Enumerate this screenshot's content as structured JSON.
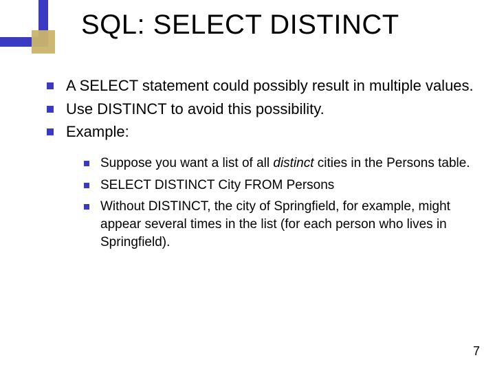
{
  "title": "SQL: SELECT DISTINCT",
  "bullets": [
    {
      "text": "A SELECT statement could possibly result in multiple values."
    },
    {
      "text": "Use DISTINCT to avoid this possibility."
    },
    {
      "text": "Example:"
    }
  ],
  "sub_bullets": [
    {
      "pre": "Suppose you want a list of all ",
      "em": "distinct",
      "post": " cities in the Persons table."
    },
    {
      "pre": "SELECT DISTINCT City FROM Persons",
      "em": "",
      "post": ""
    },
    {
      "pre": "Without DISTINCT, the city of Springfield, for example, might appear several times in the list (for each person who lives in Springfield).",
      "em": "",
      "post": ""
    }
  ],
  "page_number": "7"
}
